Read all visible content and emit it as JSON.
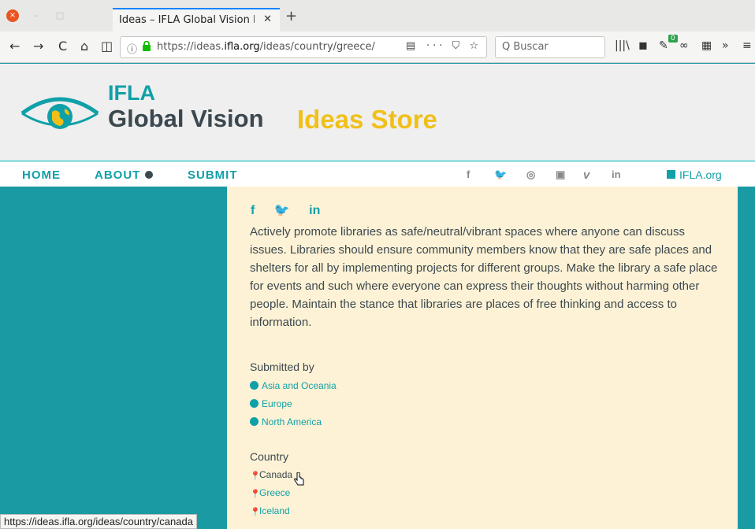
{
  "browser": {
    "window_close_glyph": "×",
    "window_min_glyph": "–",
    "window_max_glyph": "□",
    "tab_title": "Ideas – IFLA Global Vision Id",
    "tab_close_glyph": "✕",
    "new_tab_glyph": "+",
    "nav": {
      "back": "←",
      "forward": "→",
      "reload": "C",
      "home": "⌂",
      "sidebar": "◫"
    },
    "url": {
      "info": "ⓘ",
      "lock": "🔒",
      "prefix": "https://ideas.",
      "domain": "ifla.org",
      "path": "/ideas/country/greece/"
    },
    "url_actions": {
      "reader": "▤",
      "more": "···",
      "pocket": "⛉",
      "bookmark": "☆"
    },
    "search_placeholder": "Q  Buscar",
    "toolbar": {
      "library": "|||\\",
      "ext1": "◼",
      "ext2": "✎",
      "ext2_badge": "0",
      "ext3": "∞",
      "ext4": "▦",
      "overflow": "»",
      "menu": "≡"
    },
    "status_url": "https://ideas.ifla.org/ideas/country/canada"
  },
  "header": {
    "ifla": "IFLA",
    "global_vision": "Global Vision",
    "ideas_store": "Ideas Store"
  },
  "menu": {
    "home": "HOME",
    "about": "ABOUT",
    "submit": "SUBMIT",
    "social": {
      "facebook": "f",
      "twitter": "🐦",
      "instagram": "◎",
      "youtube": "▣",
      "vimeo": "v",
      "linkedin": "in"
    },
    "ifla_org": "IFLA.org"
  },
  "content": {
    "share": {
      "facebook": "f",
      "twitter": "🐦",
      "linkedin": "in"
    },
    "description": "Actively promote libraries as safe/neutral/vibrant spaces where anyone can discuss issues. Libraries should ensure community members know that they are safe places and shelters for all by implementing projects for different groups. Make the library a safe place for events and such where everyone can express their thoughts without harming other people. Maintain the stance that libraries are places of free thinking and access to information.",
    "submitted_by_label": "Submitted by",
    "regions": [
      "Asia and Oceania",
      "Europe",
      "North America"
    ],
    "country_label": "Country",
    "countries": [
      "Canada",
      "Greece",
      "Iceland"
    ]
  },
  "colors": {
    "teal": "#10a0a8",
    "yellow": "#f0c018",
    "dark": "#3c4850",
    "cream": "#fdf2d5"
  }
}
